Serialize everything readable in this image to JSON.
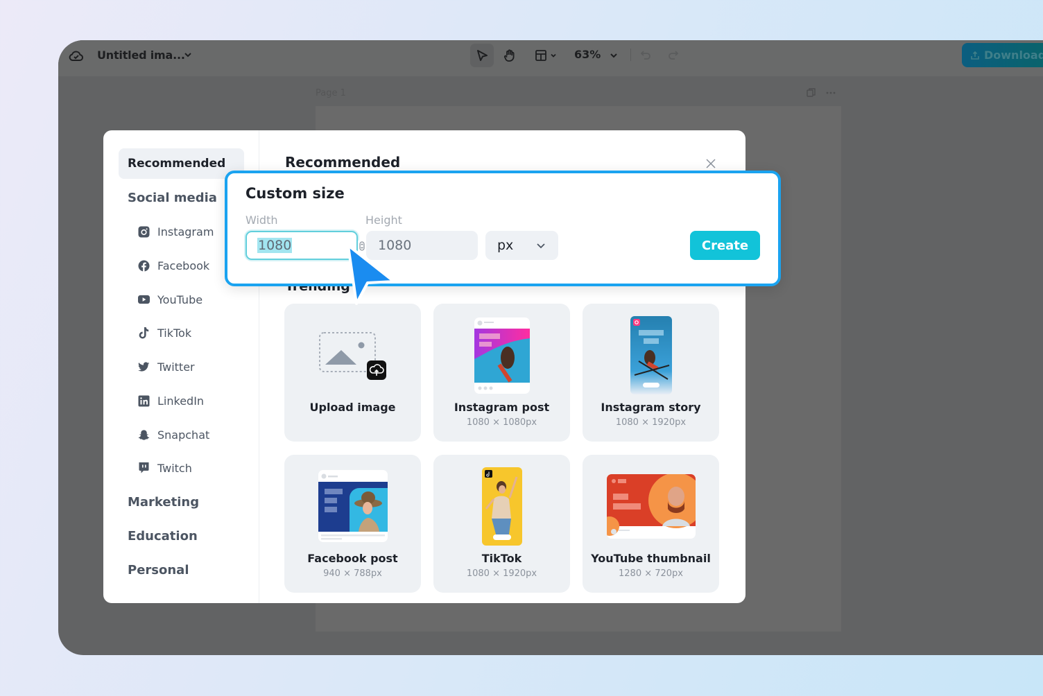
{
  "topbar": {
    "doc_title": "Untitled ima...",
    "zoom": "63%",
    "download_label": "Download",
    "icons": {
      "cloud": "cloud-check-icon",
      "select": "pointer-icon",
      "hand": "hand-icon",
      "layout": "layout-icon",
      "undo": "undo-icon",
      "redo": "redo-icon",
      "upload": "upload-icon"
    }
  },
  "canvas": {
    "page_label": "Page 1"
  },
  "modal": {
    "title": "Recommended",
    "trending_label": "Trending",
    "sidebar": {
      "active": "Recommended",
      "categories": [
        {
          "label": "Recommended"
        },
        {
          "label": "Social media"
        },
        {
          "label": "Marketing"
        },
        {
          "label": "Education"
        },
        {
          "label": "Personal"
        }
      ],
      "social_items": [
        {
          "label": "Instagram",
          "icon": "instagram-icon"
        },
        {
          "label": "Facebook",
          "icon": "facebook-icon"
        },
        {
          "label": "YouTube",
          "icon": "youtube-icon"
        },
        {
          "label": "TikTok",
          "icon": "tiktok-icon"
        },
        {
          "label": "Twitter",
          "icon": "twitter-icon"
        },
        {
          "label": "LinkedIn",
          "icon": "linkedin-icon"
        },
        {
          "label": "Snapchat",
          "icon": "snapchat-icon"
        },
        {
          "label": "Twitch",
          "icon": "twitch-icon"
        }
      ]
    },
    "cards": [
      {
        "title": "Upload image",
        "size": ""
      },
      {
        "title": "Instagram post",
        "size": "1080 × 1080px"
      },
      {
        "title": "Instagram story",
        "size": "1080 × 1920px"
      },
      {
        "title": "Facebook post",
        "size": "940 × 788px"
      },
      {
        "title": "TikTok",
        "size": "1080 × 1920px"
      },
      {
        "title": "YouTube thumbnail",
        "size": "1280 × 720px"
      }
    ]
  },
  "custom_size": {
    "title": "Custom size",
    "width_label": "Width",
    "height_label": "Height",
    "width_value": "1080",
    "height_value": "1080",
    "unit": "px",
    "create_label": "Create"
  },
  "colors": {
    "accent": "#12c3d9",
    "highlight_border": "#1aa3f0",
    "cursor": "#1a8cf0"
  }
}
